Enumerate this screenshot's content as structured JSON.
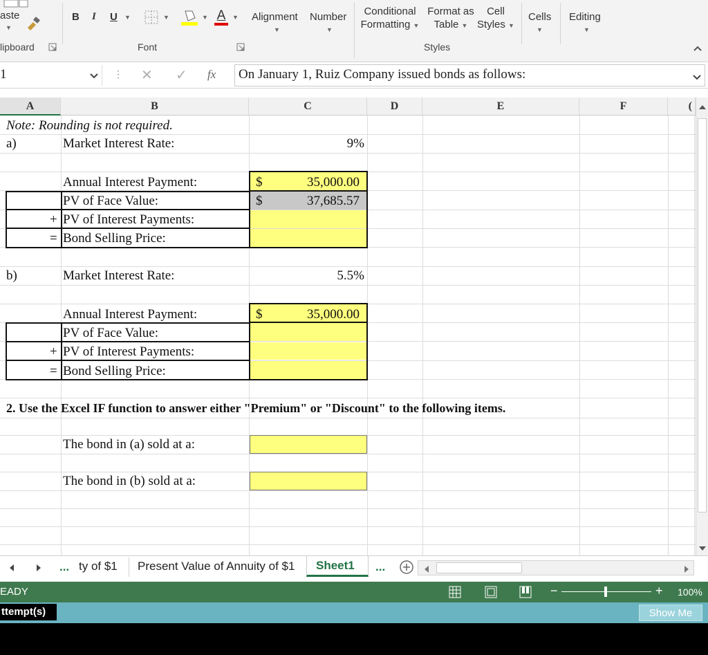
{
  "ribbon": {
    "paste": "aste",
    "bold": "B",
    "italic": "I",
    "underline": "U",
    "alignment": "Alignment",
    "number": "Number",
    "conditional_formatting_1": "Conditional",
    "conditional_formatting_2": "Formatting",
    "format_as_table_1": "Format as",
    "format_as_table_2": "Table",
    "cell_styles_1": "Cell",
    "cell_styles_2": "Styles",
    "cells": "Cells",
    "editing": "Editing",
    "font_color_letter": "A",
    "groups": {
      "clipboard": "lipboard",
      "font": "Font",
      "styles": "Styles"
    }
  },
  "formula_bar": {
    "name_box": "1",
    "fx": "fx",
    "content": "On January 1, Ruiz Company issued bonds as follows:"
  },
  "columns": [
    "A",
    "B",
    "C",
    "D",
    "E",
    "F",
    "("
  ],
  "sheet": {
    "note": "Note: Rounding is not required.",
    "a_label": "a)",
    "a_rate_label": "Market Interest Rate:",
    "a_rate": "9%",
    "a_rows": [
      {
        "op": "",
        "label": "Annual Interest Payment:",
        "dollar": "$",
        "value": "35,000.00"
      },
      {
        "op": "",
        "label": "PV of Face Value:",
        "dollar": "$",
        "value": "37,685.57"
      },
      {
        "op": "+",
        "label": "PV of Interest Payments:",
        "dollar": "",
        "value": ""
      },
      {
        "op": "=",
        "label": "Bond Selling Price:",
        "dollar": "",
        "value": ""
      }
    ],
    "b_label": "b)",
    "b_rate_label": "Market Interest Rate:",
    "b_rate": "5.5%",
    "b_rows": [
      {
        "op": "",
        "label": "Annual Interest Payment:",
        "dollar": "$",
        "value": "35,000.00"
      },
      {
        "op": "",
        "label": "PV of Face Value:",
        "dollar": "",
        "value": ""
      },
      {
        "op": "+",
        "label": "PV of Interest Payments:",
        "dollar": "",
        "value": ""
      },
      {
        "op": "=",
        "label": "Bond Selling Price:",
        "dollar": "",
        "value": ""
      }
    ],
    "question2": "2. Use the Excel IF function to answer either \"Premium\" or \"Discount\" to the following items.",
    "bond_a_text": "The bond in (a) sold at a:",
    "bond_b_text": "The bond in (b) sold at a:"
  },
  "tabs": {
    "ellipsis_left": "...",
    "tab1": "ty of $1",
    "tab2": "Present Value of Annuity of $1",
    "tab3": "Sheet1",
    "ellipsis_right": "..."
  },
  "status": {
    "ready": "EADY",
    "zoom": "100%",
    "attempts": "ttempt(s)",
    "show_me": "Show Me"
  },
  "colors": {
    "accent_green": "#3f7a4e",
    "yellow_cell": "#ffff7f",
    "gray_cell": "#c8c8c8",
    "sheet_tab": "#217346",
    "attempt_bar": "#6ab3c0"
  }
}
